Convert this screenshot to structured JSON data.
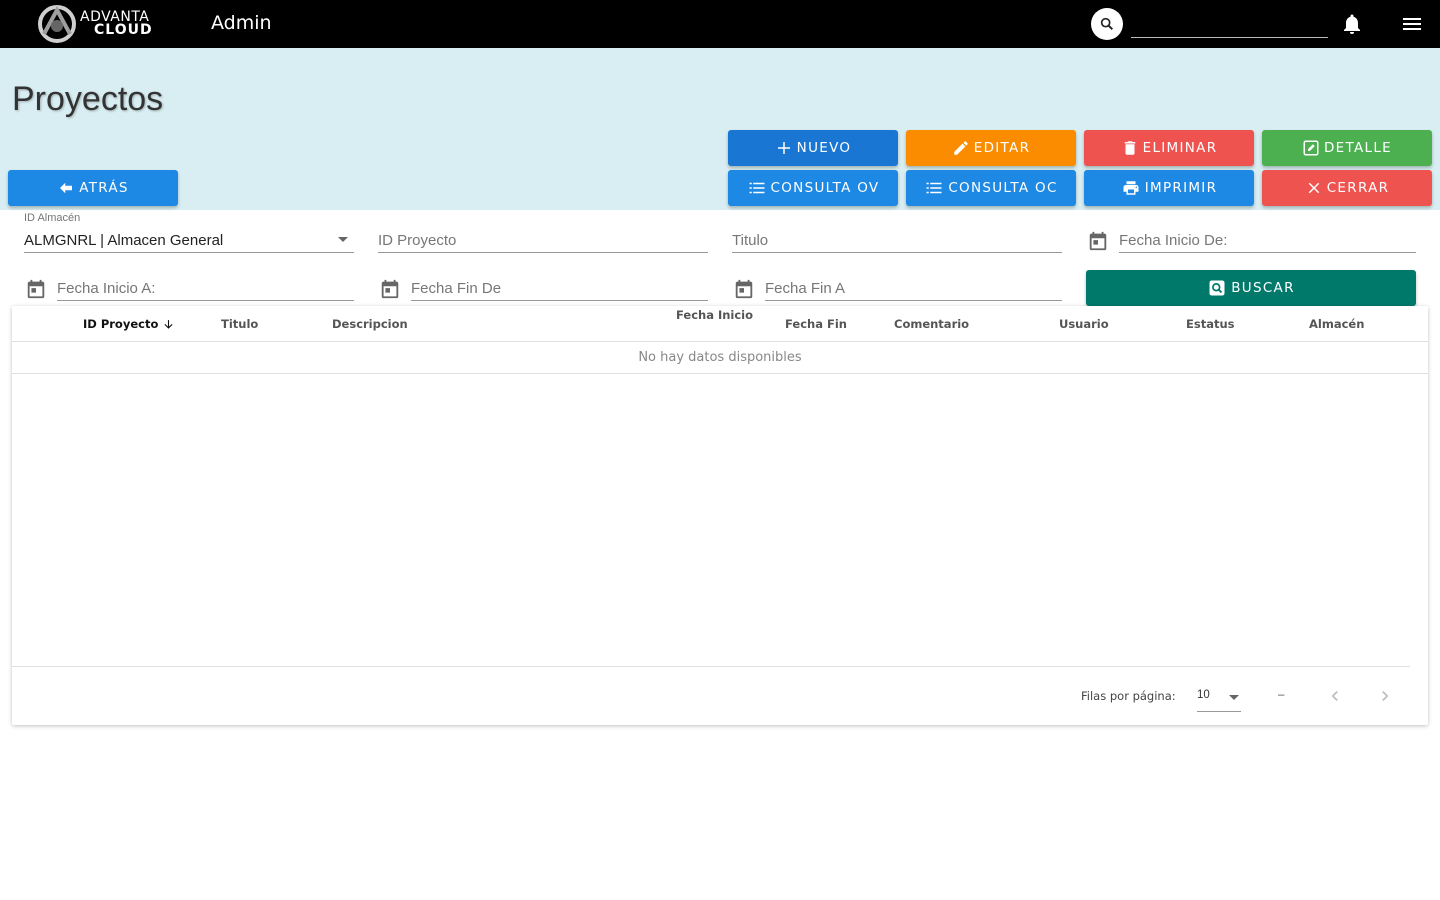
{
  "app": {
    "logo_line1": "ADVANTA",
    "logo_line2": "CLOUD",
    "section": "Admin",
    "search_placeholder": ""
  },
  "page": {
    "title": "Proyectos"
  },
  "buttons": {
    "nuevo": "Nuevo",
    "editar": "Editar",
    "eliminar": "Eliminar",
    "detalle": "Detalle",
    "atras": "Atrás",
    "consulta_ov": "Consulta OV",
    "consulta_oc": "Consulta OC",
    "imprimir": "Imprimir",
    "cerrar": "Cerrar",
    "buscar": "Buscar"
  },
  "filters": {
    "almacen_label": "ID Almacén",
    "almacen_value": "ALMGNRL | Almacen General",
    "id_proyecto": "ID Proyecto",
    "titulo": "Titulo",
    "fecha_inicio_de": "Fecha Inicio De:",
    "fecha_inicio_a": "Fecha Inicio A:",
    "fecha_fin_de": "Fecha Fin De",
    "fecha_fin_a": "Fecha Fin A"
  },
  "table": {
    "columns": [
      "ID Proyecto",
      "Titulo",
      "Descripcion",
      "Fecha Inicio",
      "Fecha Fin",
      "Comentario",
      "Usuario",
      "Estatus",
      "Almacén"
    ],
    "no_data": "No hay datos disponibles",
    "rows_per_page_label": "Filas por página:",
    "rows_per_page": "10",
    "range": "–"
  },
  "colors": {
    "topbar": "#000000",
    "band": "#d8eef2",
    "blue": "#1e88e5",
    "orange": "#fb8c00",
    "red": "#ef5350",
    "green": "#4caf50",
    "teal": "#00796b"
  }
}
